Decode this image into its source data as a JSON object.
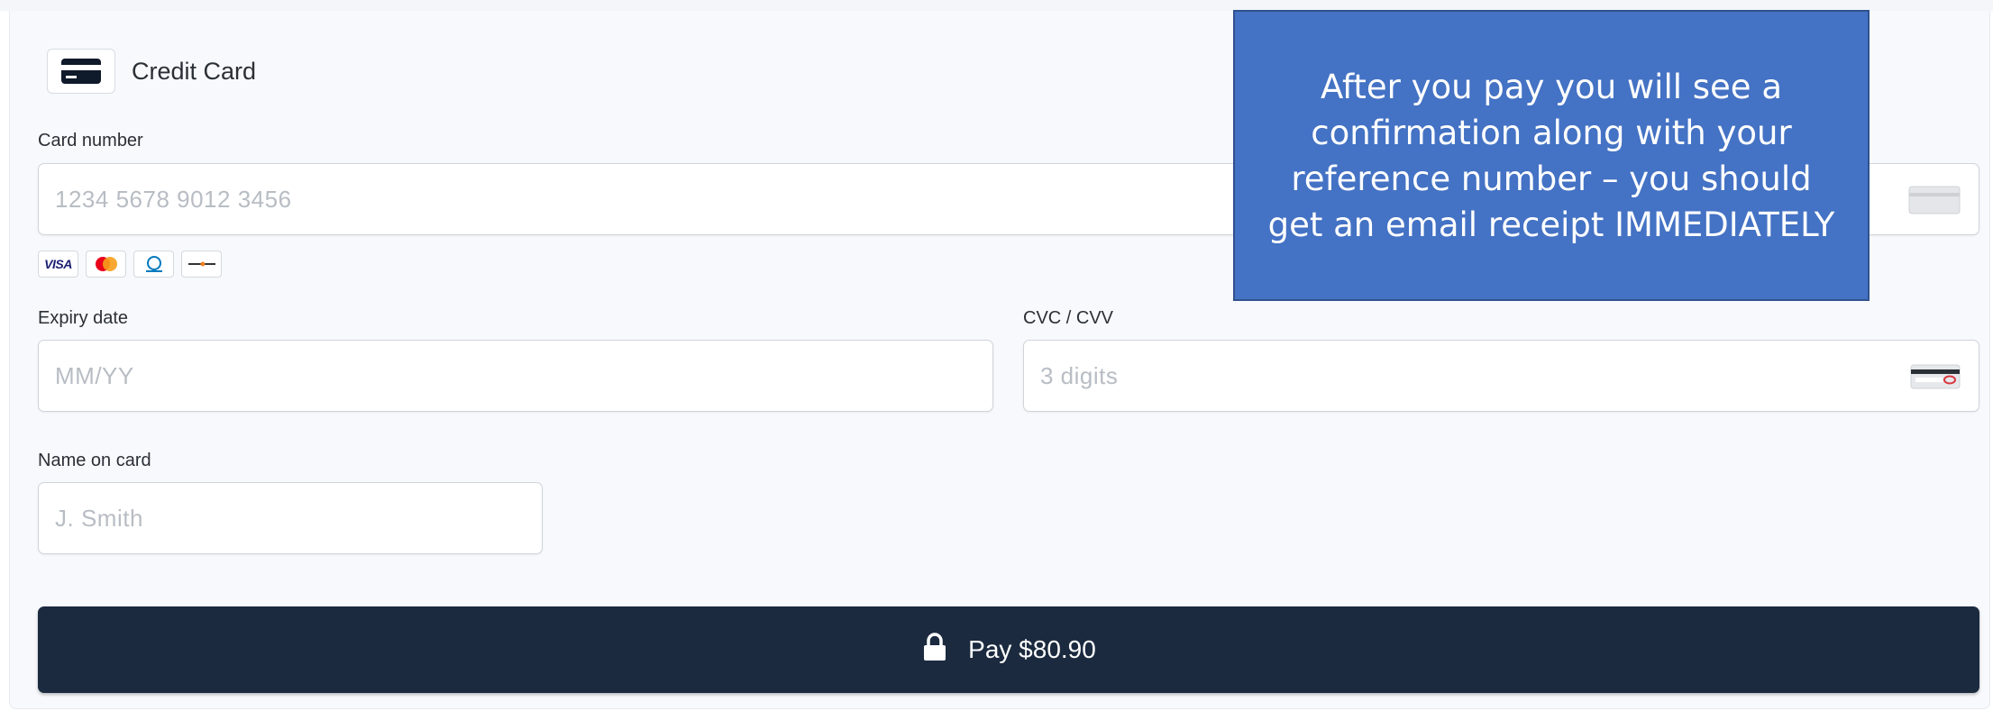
{
  "payment_method": {
    "label": "Credit Card",
    "icon": "credit-card-icon"
  },
  "fields": {
    "card_number": {
      "label": "Card number",
      "placeholder": "1234 5678 9012 3456",
      "value": ""
    },
    "expiry": {
      "label": "Expiry date",
      "placeholder": "MM/YY",
      "value": ""
    },
    "cvc": {
      "label": "CVC / CVV",
      "placeholder": "3 digits",
      "value": ""
    },
    "name": {
      "label": "Name on card",
      "placeholder": "J. Smith",
      "value": ""
    }
  },
  "brands": [
    {
      "name": "VISA"
    },
    {
      "name": "Mastercard"
    },
    {
      "name": "Diners Club"
    },
    {
      "name": "DISCOVER"
    }
  ],
  "pay_button": {
    "label": "Pay $80.90",
    "icon": "lock-icon"
  },
  "callout": {
    "text": "After you pay you will see a confirmation along with your reference number – you should get an email receipt IMMEDIATELY"
  },
  "colors": {
    "button_bg": "#1b2a3f",
    "callout_bg": "#4472c4",
    "panel_bg": "#f7f9fc"
  }
}
